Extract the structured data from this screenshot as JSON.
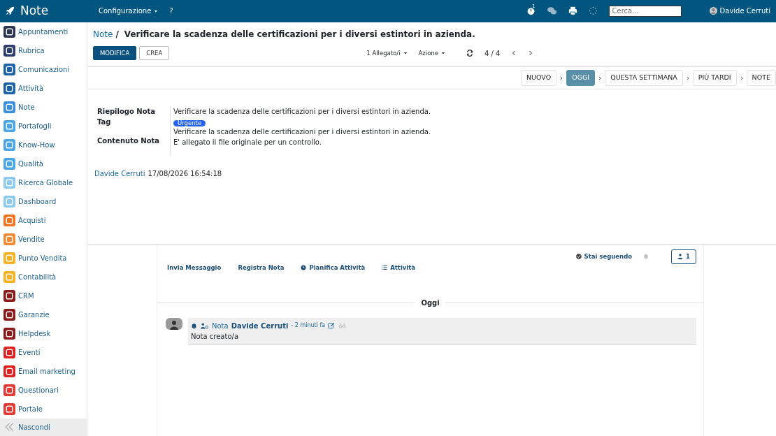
{
  "app": {
    "title": "Note",
    "menus": [
      {
        "label": "Configurazione",
        "dropdown": true
      },
      {
        "label": "?",
        "dropdown": false
      }
    ],
    "search": {
      "placeholder": "Cerca..."
    },
    "user": "Davide Cerruti",
    "activity_count": "1"
  },
  "sidebar": {
    "items": [
      {
        "label": "Appuntamenti",
        "color": "#2b3550"
      },
      {
        "label": "Rubrica",
        "color": "#2c3d6e"
      },
      {
        "label": "Comunicazioni",
        "color": "#1e63a8"
      },
      {
        "label": "Attività",
        "color": "#1e63a8"
      },
      {
        "label": "Note",
        "color": "#3a8fde"
      },
      {
        "label": "Portafogli",
        "color": "#4aa6e6"
      },
      {
        "label": "Know-How",
        "color": "#4aa6e6"
      },
      {
        "label": "Qualità",
        "color": "#4aa6e6"
      },
      {
        "label": "Ricerca Globale",
        "color": "#8ccbee"
      },
      {
        "label": "Dashboard",
        "color": "#8ccbee"
      },
      {
        "label": "Acquisti",
        "color": "#ef7521"
      },
      {
        "label": "Vendite",
        "color": "#f08a35"
      },
      {
        "label": "Punto Vendita",
        "color": "#f4b224"
      },
      {
        "label": "Contabilità",
        "color": "#f4b224"
      },
      {
        "label": "CRM",
        "color": "#8e1b1b"
      },
      {
        "label": "Garanzie",
        "color": "#8e1b1b"
      },
      {
        "label": "Helpdesk",
        "color": "#8e1b1b"
      },
      {
        "label": "Eventi",
        "color": "#dd2222"
      },
      {
        "label": "Email marketing",
        "color": "#dd2222"
      },
      {
        "label": "Questionari",
        "color": "#e43a36"
      },
      {
        "label": "Portale",
        "color": "#e43a36"
      }
    ],
    "collapse": "Nascondi"
  },
  "breadcrumb": {
    "parent": "Note",
    "separator": "/",
    "current": "Verificare la scadenza delle certificazioni per i diversi estintori in azienda."
  },
  "toolbar": {
    "buttons": [
      {
        "label": "MODIFICA",
        "primary": true
      },
      {
        "label": "CREA",
        "primary": false
      }
    ],
    "attachments": "1 Allegato/i",
    "action": "Azione",
    "pager": "4 / 4"
  },
  "stages": [
    {
      "label": "NUOVO",
      "selected": false
    },
    {
      "label": "OGGI",
      "selected": true
    },
    {
      "label": "QUESTA SETTIMANA",
      "selected": false
    },
    {
      "label": "PIÙ TARDI",
      "selected": false
    },
    {
      "label": "NOTE",
      "selected": false
    }
  ],
  "form": {
    "labels": [
      "Riepilogo Nota",
      "Tag",
      "Contenuto Nota"
    ],
    "summary": "Verificare la scadenza delle certificazioni per i diversi estintori in azienda.",
    "tag": "Urgente",
    "content": [
      "Verificare la scadenza delle certificazioni per i diversi estintori in azienda.",
      "E' allegato il file originale per un controllo."
    ],
    "author": "Davide Cerruti",
    "date": "17/08/2026 16:54:18"
  },
  "chatter": {
    "actions": [
      {
        "label": "Invia Messaggio",
        "kind": "plain"
      },
      {
        "label": "Registra Nota",
        "kind": "plain"
      },
      {
        "label": "Pianifica Attività",
        "kind": "schedule"
      },
      {
        "label": "Attività",
        "kind": "list"
      }
    ],
    "following": "Stai seguendo",
    "followers": "1",
    "divider": "Oggi",
    "messages": [
      {
        "type": "Nota",
        "author": "Davide Cerruti",
        "time": "- 2 minuti fa",
        "body": "Nota creato/a"
      }
    ]
  }
}
